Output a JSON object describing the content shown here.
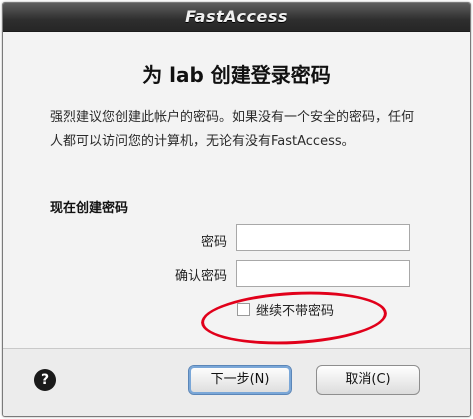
{
  "window": {
    "title": "FastAccess"
  },
  "heading": "为 lab 创建登录密码",
  "description": "强烈建议您创建此帐户的密码。如果没有一个安全的密码，任何人都可以访问您的计算机，无论有没有FastAccess。",
  "form": {
    "section_label": "现在创建密码",
    "password_label": "密码",
    "confirm_label": "确认密码",
    "password_value": "",
    "confirm_value": "",
    "continue_without_label": "继续不带密码",
    "continue_without_checked": false
  },
  "footer": {
    "help_glyph": "?",
    "next_label": "下一步(N)",
    "cancel_label": "取消(C)"
  },
  "colors": {
    "highlight": "#e1001a",
    "titlebar": "#2e2e2e"
  }
}
